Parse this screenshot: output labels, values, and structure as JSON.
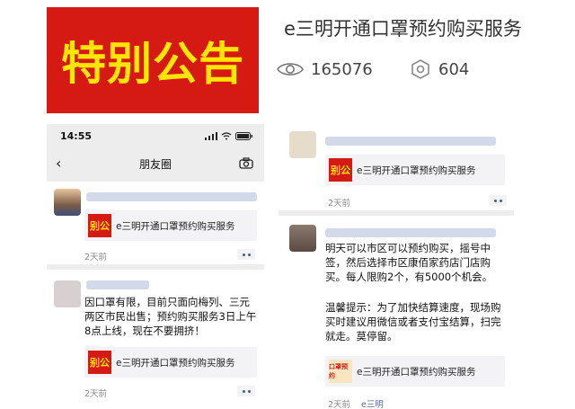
{
  "banner": {
    "text": "特别公告"
  },
  "article": {
    "title": "e三明开通口罩预约购买服务",
    "views": "165076",
    "shares": "604"
  },
  "phone": {
    "time": "14:55",
    "nav_title": "朋友圈",
    "back_icon": "‹"
  },
  "left_posts": {
    "post1": {
      "card_title": "e三明开通口罩预约购买服务",
      "time": "2天前"
    },
    "post2": {
      "text": "因口罩有限，目前只面向梅列、三元两区市民出售；预约购买服务3日上午8点上线，现在不要拥挤！",
      "card_title": "e三明开通口罩预约购买服务",
      "time": "2天前"
    }
  },
  "right_posts": {
    "post1": {
      "card_title": "e三明开通口罩预约购买服务",
      "time": "2天前"
    },
    "post2": {
      "text": "明天可以市区可以预约购买，摇号中签，然后选择市区康佰家药店门店购买。每人限购2个，有5000个机会。",
      "tip": "温馨提示：为了加快结算速度，现场购买时建议用微信或者支付宝结算，扫完就走。莫停留。",
      "card_title": "e三明开通口罩预约购买服务",
      "time": "2天前",
      "source": "e三明"
    }
  },
  "thumb_label": "别公",
  "thumb_label_alt": "口罩预约"
}
